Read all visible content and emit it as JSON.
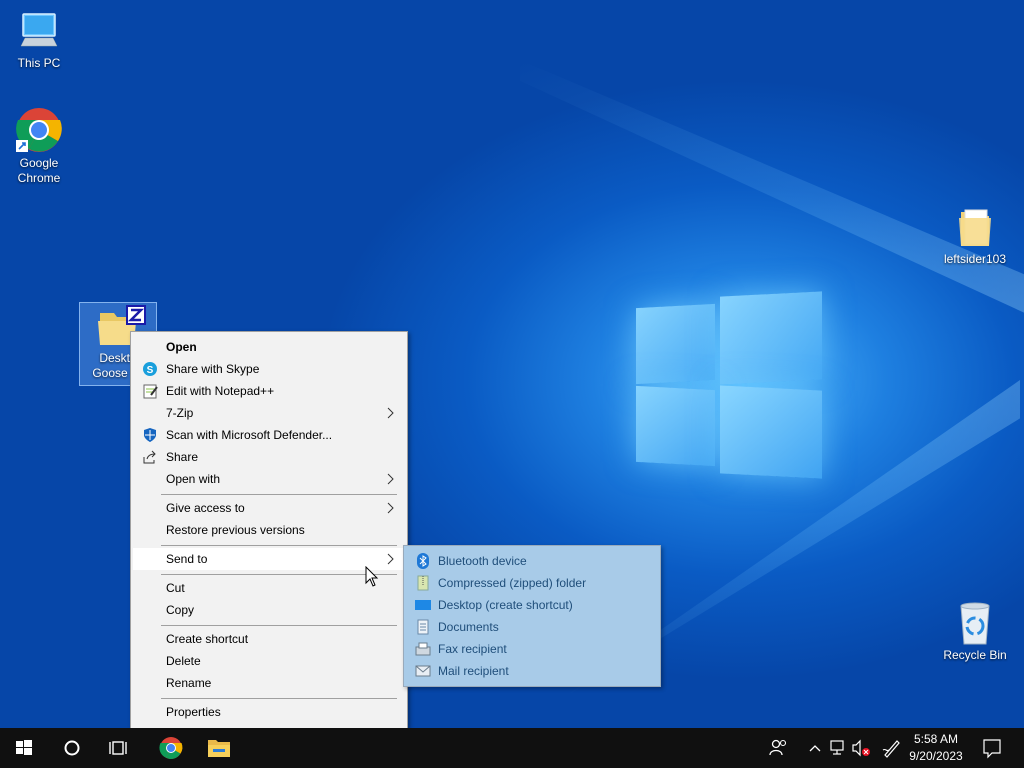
{
  "desktop": {
    "icons": [
      {
        "label": "This PC",
        "icon": "computer-icon"
      },
      {
        "label_line1": "Google",
        "label_line2": "Chrome",
        "icon": "chrome-icon"
      },
      {
        "label": "leftsider103",
        "icon": "folder-icon"
      },
      {
        "label": "Recycle Bin",
        "icon": "recycle-bin-icon"
      },
      {
        "label_line1": "Deskto",
        "label_line2": "Goose v0",
        "icon": "zip-folder-icon"
      }
    ]
  },
  "context_menu": {
    "items": [
      {
        "label": "Open",
        "bold": true
      },
      {
        "label": "Share with Skype",
        "icon": "skype-icon"
      },
      {
        "label": "Edit with Notepad++",
        "icon": "notepadpp-icon"
      },
      {
        "label": "7-Zip",
        "submenu": true
      },
      {
        "label": "Scan with Microsoft Defender...",
        "icon": "defender-icon"
      },
      {
        "label": "Share",
        "icon": "share-icon"
      },
      {
        "label": "Open with",
        "submenu": true
      },
      {
        "label": "Give access to",
        "submenu": true
      },
      {
        "label": "Restore previous versions"
      },
      {
        "label": "Send to",
        "submenu": true,
        "highlighted": true
      },
      {
        "label": "Cut"
      },
      {
        "label": "Copy"
      },
      {
        "label": "Create shortcut"
      },
      {
        "label": "Delete"
      },
      {
        "label": "Rename"
      },
      {
        "label": "Properties"
      }
    ]
  },
  "send_to_menu": {
    "items": [
      {
        "label": "Bluetooth device",
        "icon": "bluetooth-icon"
      },
      {
        "label": "Compressed (zipped) folder",
        "icon": "zip-icon"
      },
      {
        "label": "Desktop (create shortcut)",
        "icon": "desktop-icon"
      },
      {
        "label": "Documents",
        "icon": "documents-icon"
      },
      {
        "label": "Fax recipient",
        "icon": "fax-icon"
      },
      {
        "label": "Mail recipient",
        "icon": "mail-icon"
      }
    ]
  },
  "taskbar": {
    "clock_time": "5:58 AM",
    "clock_date": "9/20/2023"
  },
  "colors": {
    "accent": "#0078d7",
    "taskbar": "#101010",
    "menu_bg": "#f2f2f2",
    "submenu_bg": "#a8cbe8"
  }
}
